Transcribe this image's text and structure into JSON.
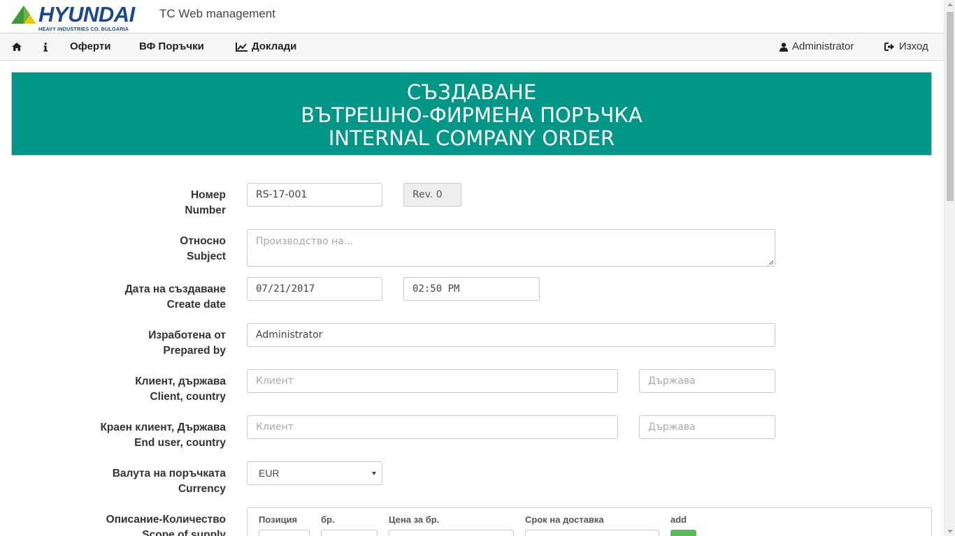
{
  "brand": {
    "logo_word": "HYUNDAI",
    "logo_sub": "HEAVY INDUSTRIES CO. BULGARIA",
    "app_title": "TC Web management"
  },
  "nav": {
    "home_icon": "home-icon",
    "info_icon": "info-icon",
    "offers": "Оферти",
    "orders": "ВФ Поръчки",
    "reports": "Доклади",
    "reports_icon": "line-chart-icon",
    "user": "Administrator",
    "user_icon": "user-icon",
    "logout": "Изход",
    "logout_icon": "sign-out-icon"
  },
  "banner": {
    "line1": "СЪЗДАВАНЕ",
    "line2": "ВЪТРЕШНО-ФИРМЕНА ПОРЪЧКА",
    "line3": "INTERNAL COMPANY ORDER",
    "color": "#009688"
  },
  "form": {
    "number": {
      "label_bg": "Номер",
      "label_en": "Number",
      "value": "RS-17-001",
      "rev": "Rev. 0"
    },
    "subject": {
      "label_bg": "Относно",
      "label_en": "Subject",
      "placeholder": "Производство на..."
    },
    "create_date": {
      "label_bg": "Дата на създаване",
      "label_en": "Create date",
      "date": "07/21/2017",
      "time": "02:50 PM"
    },
    "prepared_by": {
      "label_bg": "Изработена от",
      "label_en": "Prepared by",
      "value": "Administrator"
    },
    "client": {
      "label_bg": "Клиент, държава",
      "label_en": "Client, country",
      "client_placeholder": "Клиент",
      "country_placeholder": "Държава"
    },
    "end_user": {
      "label_bg": "Краен клиент, Държава",
      "label_en": "End user, country",
      "client_placeholder": "Клиент",
      "country_placeholder": "Държава"
    },
    "currency": {
      "label_bg": "Валута на поръчката",
      "label_en": "Currency",
      "value": "EUR"
    },
    "scope": {
      "label_bg": "Описание-Количество",
      "label_en": "Scope of supply",
      "col_position": "Позиция",
      "col_qty": "бр.",
      "col_price": "Цена за бр.",
      "col_delivery": "Срок на доставка",
      "col_add": "add"
    }
  }
}
